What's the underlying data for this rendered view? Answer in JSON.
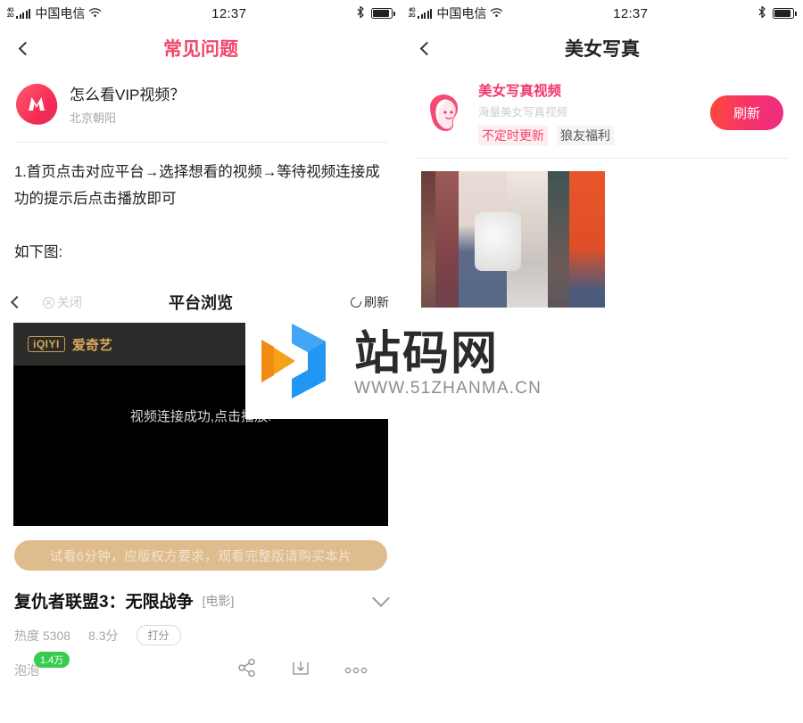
{
  "status_bar": {
    "network_4g": "4G",
    "network_2g": "2G",
    "carrier": "中国电信",
    "time": "12:37"
  },
  "left_screen": {
    "nav": {
      "title": "常见问题",
      "back_icon": "chevron-left-icon",
      "title_color": "#f2456a"
    },
    "question": {
      "title": "怎么看VIP视频？",
      "subtitle": "北京朝阳",
      "app_icon": "meitu-app-icon"
    },
    "body": {
      "step_1": "1.首页点击对应平台→选择想看的视频→等待视频连接成功的提示后点击播放即可",
      "as_shown": "如下图:"
    },
    "embedded_shot": {
      "nav": {
        "back_icon": "chevron-left-icon",
        "close_icon": "circle-close-icon",
        "close_label": "关闭",
        "title": "平台浏览",
        "refresh_icon": "refresh-circle-icon",
        "refresh_label": "刷新"
      },
      "iqiyi": {
        "logo_mark": "iQIYI",
        "logo_text": "爱奇艺",
        "menu_icon": "hamburger-menu-icon",
        "search_icon": "search-icon"
      },
      "player": {
        "message": "视频连接成功,点击播放!"
      },
      "trial_notice": "试看6分钟，应版权方要求，观看完整版请购买本片",
      "video": {
        "title": "复仇者联盟3：无限战争",
        "category": "[电影]",
        "expand_icon": "chevron-down-icon",
        "heat_label": "热度 5308",
        "score": "8.3分",
        "rate_button": "打分",
        "bubble_label": "泡泡",
        "bubble_count": "1.4万",
        "bubble_color": "#37cc4e",
        "share_icon": "share-icon",
        "download_icon": "download-icon",
        "more_icon": "more-dots-icon"
      }
    }
  },
  "right_screen": {
    "nav": {
      "title": "美女写真",
      "back_icon": "chevron-left-icon",
      "title_color": "#222222"
    },
    "channel": {
      "icon": "girl-face-icon",
      "title": "美女写真视频",
      "subtitle": "海量美女写真视频",
      "tags": [
        {
          "label": "不定时更新",
          "style": "pink"
        },
        {
          "label": "狼友福利",
          "style": "gray"
        }
      ],
      "refresh_button": "刷新",
      "refresh_color": "#f5326a"
    },
    "thumbnail": "street-fashion-photo"
  },
  "watermark": {
    "logo_icon": "play-hexagon-icon",
    "brand": "站码网",
    "url": "WWW.51ZHANMA.CN",
    "blue": "#2196f3",
    "orange": "#f7a118"
  }
}
